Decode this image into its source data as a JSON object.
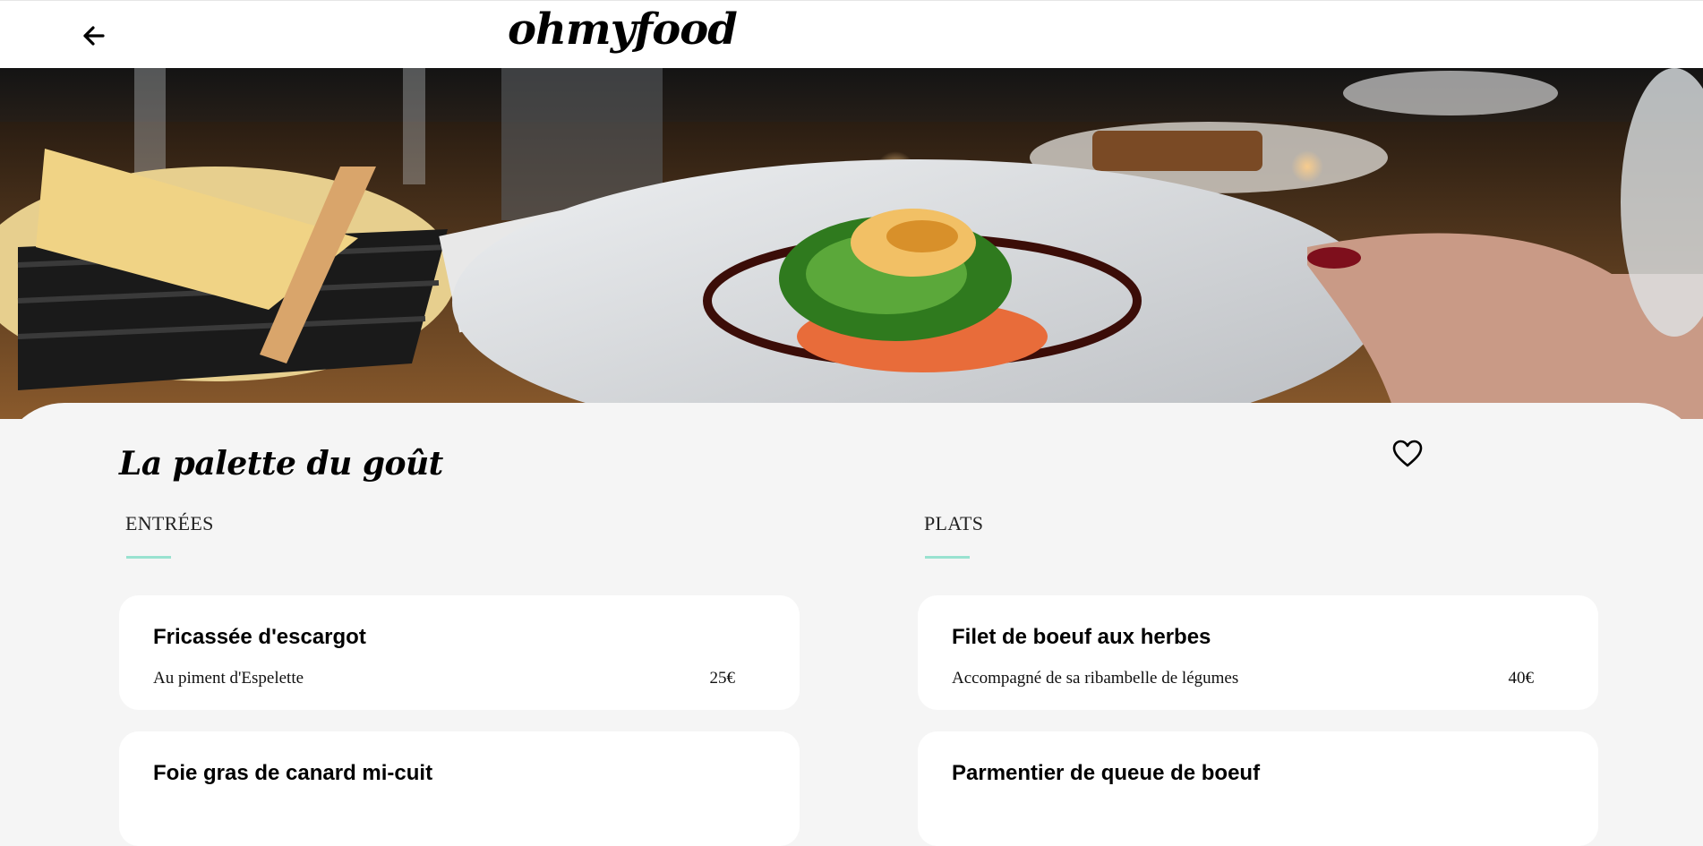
{
  "header": {
    "logo": "ohmyfood",
    "back_icon": "arrow-left-icon"
  },
  "hero": {
    "image": "restaurant-dish-photo"
  },
  "restaurant": {
    "name": "La palette du goût",
    "favorite_icon": "heart-outline-icon"
  },
  "menu": {
    "sections": [
      {
        "title": "ENTRÉES",
        "items": [
          {
            "name": "Fricassée d'escargot",
            "description": "Au piment d'Espelette",
            "price": "25€"
          },
          {
            "name": "Foie gras de canard mi-cuit",
            "description": "",
            "price": ""
          }
        ]
      },
      {
        "title": "PLATS",
        "items": [
          {
            "name": "Filet de boeuf aux herbes",
            "description": "Accompagné de sa ribambelle de légumes",
            "price": "40€"
          },
          {
            "name": "Parmentier de queue de boeuf",
            "description": "",
            "price": ""
          }
        ]
      }
    ]
  },
  "colors": {
    "accent": "#99e2d0",
    "background": "#f5f5f5",
    "card": "#ffffff"
  }
}
